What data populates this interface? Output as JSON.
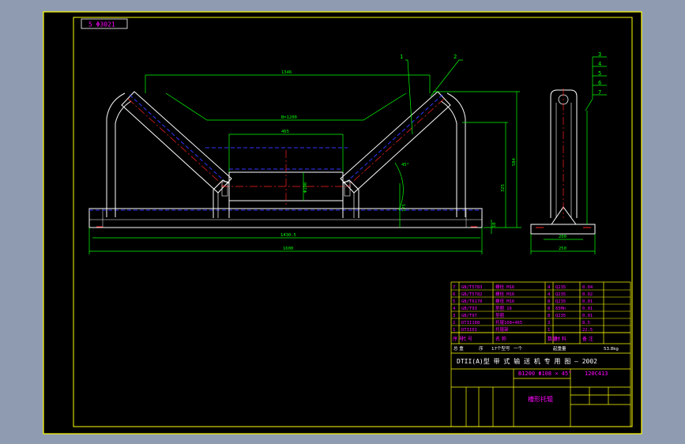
{
  "colors": {
    "background": "#8e9bb1",
    "paper": "#000000",
    "border": "#ffff00",
    "outline": "#ffffff",
    "dimension": "#00ff00",
    "hidden_line": "#3333ff",
    "center_line": "#ff2020",
    "table_text": "#ff00ff"
  },
  "drawing": {
    "corner_label": "5 Φ3021",
    "dimensions": {
      "top_span": "1346",
      "bracket_span": "B=1200",
      "center_roller": "465",
      "roller_dia": "Φ108",
      "overall_length": "1430.5",
      "base_length": "1600",
      "height_total": "584",
      "height_mid": "325",
      "height_small": "175",
      "base_thk": "10",
      "angle": "45°",
      "side_width": "200",
      "side_base": "250"
    },
    "callouts_front": [
      "1",
      "2"
    ],
    "callouts_side": [
      "3",
      "4",
      "5",
      "6",
      "7"
    ]
  },
  "bom": {
    "rows": [
      [
        "7",
        "GB/T5783",
        "螺栓 M16",
        "4",
        "Q235",
        "0.04"
      ],
      [
        "6",
        "GB/T5782",
        "螺栓 M16",
        "4",
        "Q235",
        "0.02"
      ],
      [
        "5",
        "GB/T6170",
        "螺母 M16",
        "8",
        "Q235",
        "0.01"
      ],
      [
        "4",
        "GB/T93",
        "垫圈 16",
        "8",
        "65Mn",
        "0.01"
      ],
      [
        "3",
        "GB/T97",
        "垫圈",
        "8",
        "Q235",
        "0.01"
      ],
      [
        "2",
        "DTII108",
        "托辊108×465",
        "3",
        "",
        "8.5"
      ],
      [
        "1",
        "DTII01",
        "托辊架",
        "1",
        "",
        "22.5"
      ]
    ],
    "header": [
      "序 号",
      "代   号",
      "名   称",
      "数量",
      "材 料",
      "备 注"
    ],
    "summary_row": [
      "总 重",
      "",
      "序",
      "17个型号",
      "一个",
      "起重量",
      "53.8kg"
    ],
    "title": "DTII(A)型   带 式 输 送 机 专 用 图 – 2002",
    "spec": "B1200  Φ108  ×  45°",
    "drawing_no": "120C413",
    "part_name": "槽形托辊"
  }
}
